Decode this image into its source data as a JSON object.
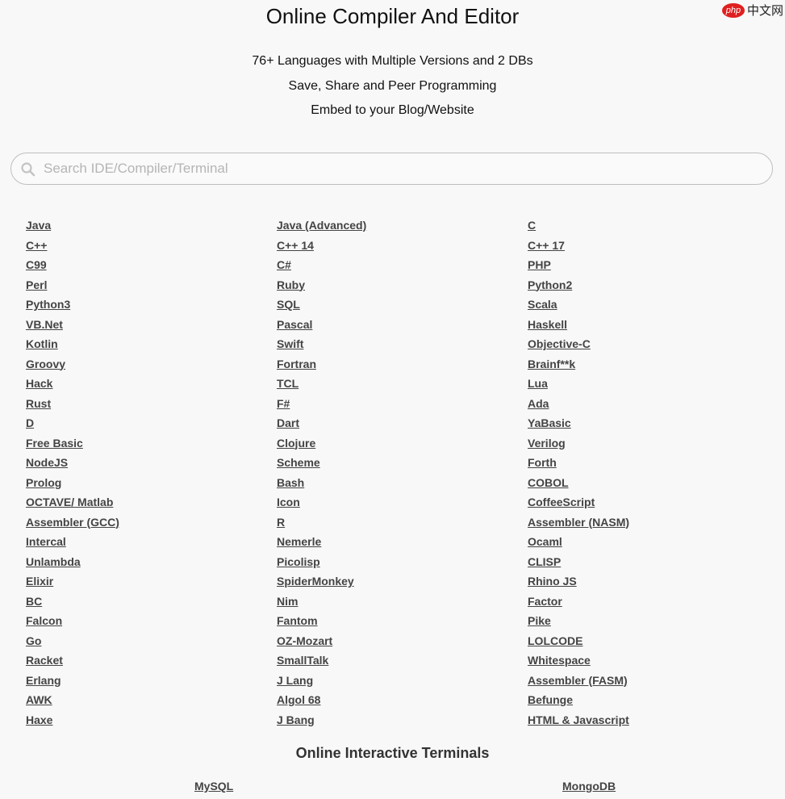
{
  "header": {
    "title": "Online Compiler And Editor",
    "taglines": [
      "76+ Languages with Multiple Versions and 2 DBs",
      "Save, Share and Peer Programming",
      "Embed to your Blog/Website"
    ]
  },
  "watermark": {
    "logo_text": "php",
    "text": "中文网"
  },
  "search": {
    "placeholder": "Search IDE/Compiler/Terminal",
    "value": ""
  },
  "languages": [
    "Java",
    "Java (Advanced)",
    "C",
    "C++",
    "C++ 14",
    "C++ 17",
    "C99",
    "C#",
    "PHP",
    "Perl",
    "Ruby",
    "Python2",
    "Python3",
    "SQL",
    "Scala",
    "VB.Net",
    "Pascal",
    "Haskell",
    "Kotlin",
    "Swift",
    "Objective-C",
    "Groovy",
    "Fortran",
    "Brainf**k",
    "Hack",
    "TCL",
    "Lua",
    "Rust",
    "F#",
    "Ada",
    "D",
    "Dart",
    "YaBasic",
    "Free Basic",
    "Clojure",
    "Verilog",
    "NodeJS",
    "Scheme",
    "Forth",
    "Prolog",
    "Bash",
    "COBOL",
    "OCTAVE/ Matlab",
    "Icon",
    "CoffeeScript",
    "Assembler (GCC)",
    "R",
    "Assembler (NASM)",
    "Intercal",
    "Nemerle",
    "Ocaml",
    "Unlambda",
    "Picolisp",
    "CLISP",
    "Elixir",
    "SpiderMonkey",
    "Rhino JS",
    "BC",
    "Nim",
    "Factor",
    "Falcon",
    "Fantom",
    "Pike",
    "Go",
    "OZ-Mozart",
    "LOLCODE",
    "Racket",
    "SmallTalk",
    "Whitespace",
    "Erlang",
    "J Lang",
    "Assembler (FASM)",
    "AWK",
    "Algol 68",
    "Befunge",
    "Haxe",
    "J Bang",
    "HTML & Javascript"
  ],
  "terminals": {
    "title": "Online Interactive Terminals",
    "items": [
      "MySQL",
      "MongoDB"
    ]
  }
}
